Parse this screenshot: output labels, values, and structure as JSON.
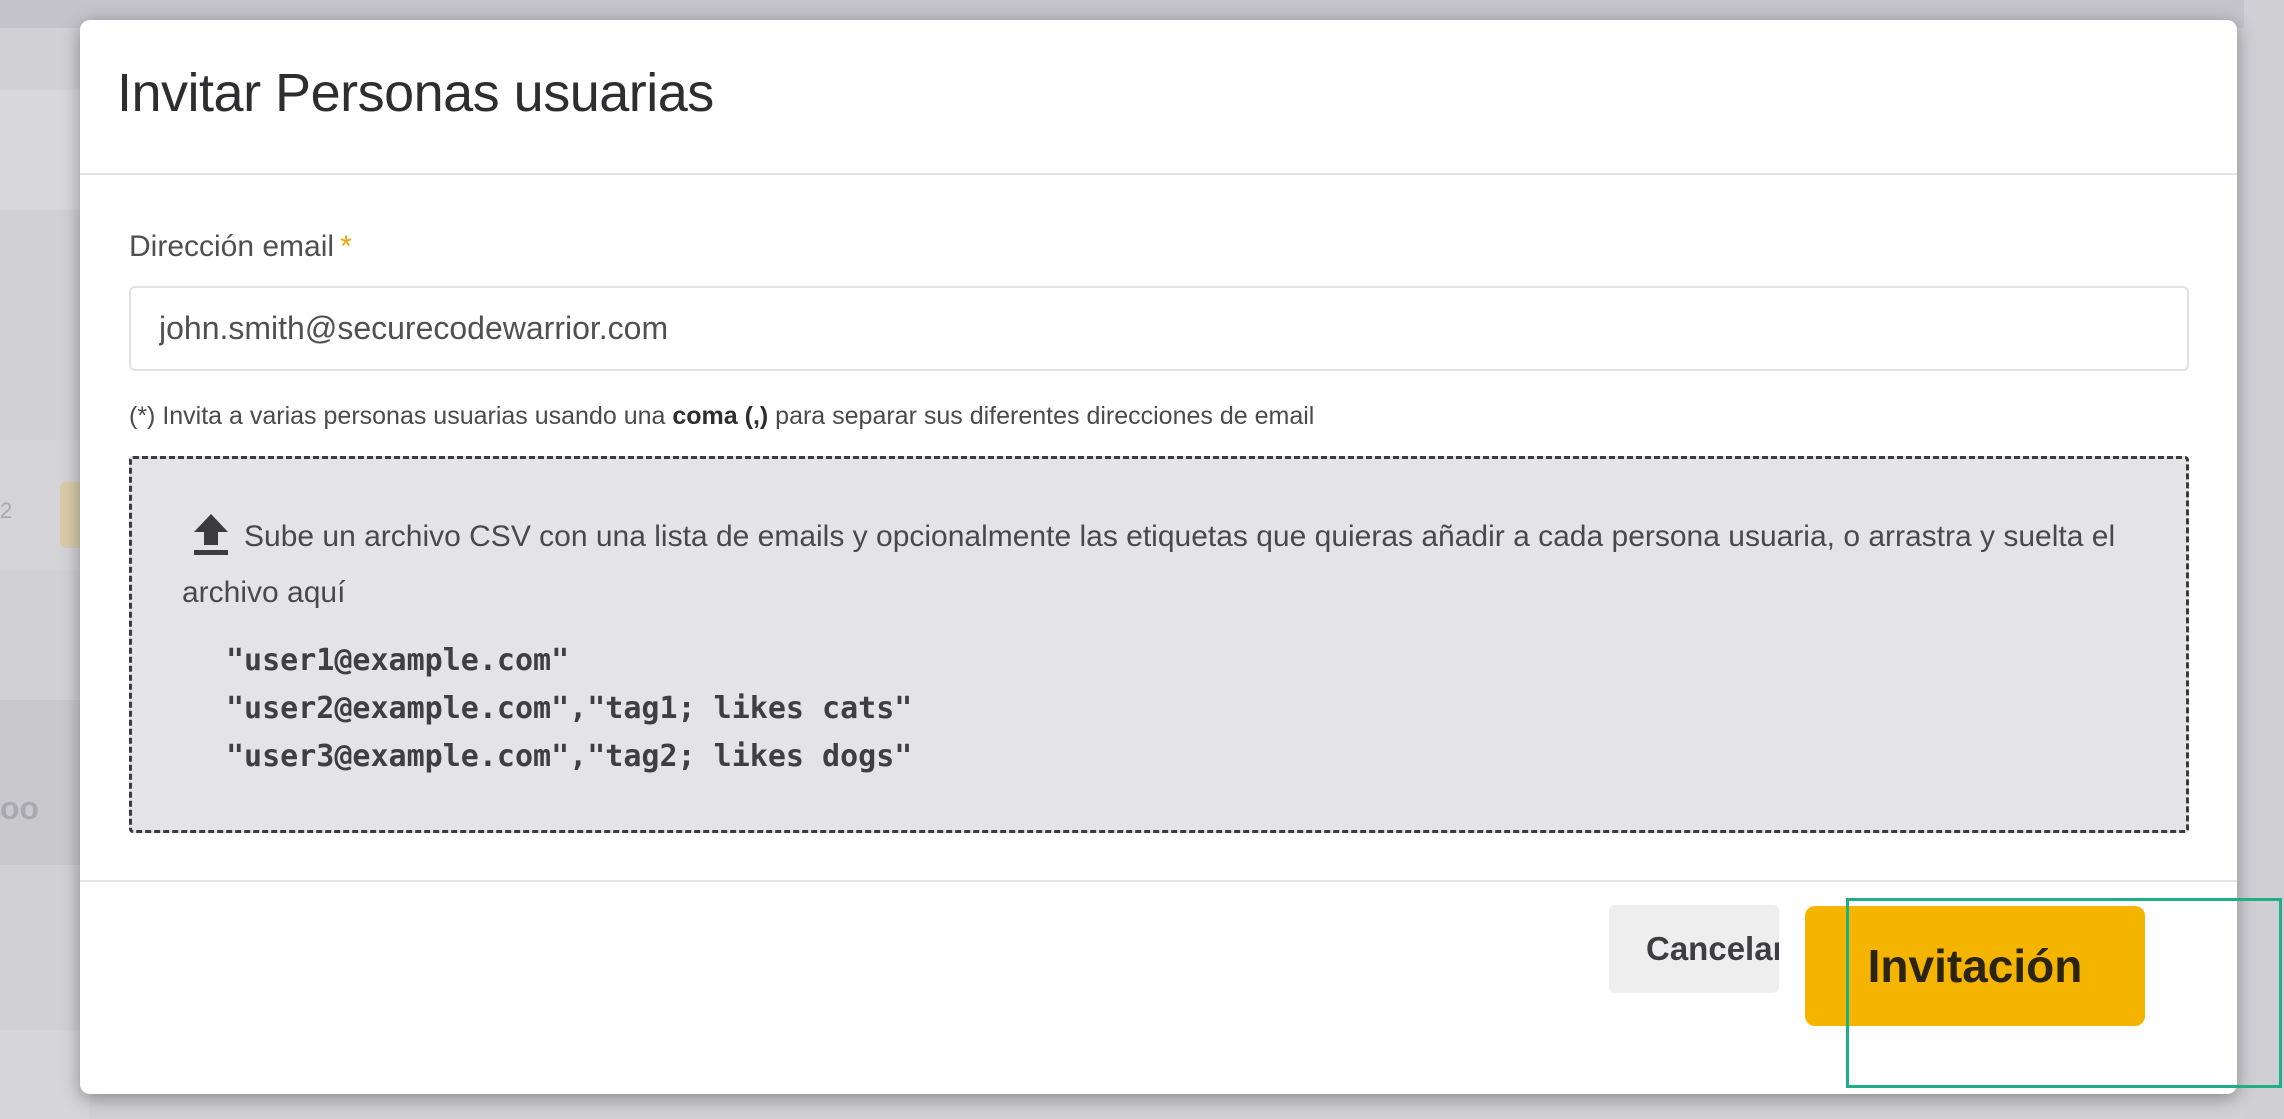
{
  "background": {
    "fragment_1": "2",
    "fragment_2": "oo"
  },
  "modal": {
    "title": "Invitar Personas usuarias",
    "email_field": {
      "label": "Dirección email",
      "required_marker": "*",
      "value": "john.smith@securecodewarrior.com"
    },
    "help": {
      "prefix": "(*) Invita a varias personas usuarias usando una ",
      "emphasis": "coma (,)",
      "suffix": " para separar sus diferentes direcciones de email"
    },
    "dropzone": {
      "icon": "upload-icon",
      "text": "Sube un archivo CSV con una lista de emails y opcionalmente las etiquetas que quieras añadir a cada persona usuaria, o arrastra y suelta el archivo aquí",
      "sample_lines": [
        "\"user1@example.com\"",
        "\"user2@example.com\",\"tag1; likes cats\"",
        "\"user3@example.com\",\"tag2; likes dogs\""
      ]
    },
    "footer": {
      "cancel_label": "Cancelar",
      "invite_label": "Invitación"
    }
  },
  "colors": {
    "accent": "#f4b400",
    "highlight": "#1fae86",
    "required": "#f0a500"
  }
}
